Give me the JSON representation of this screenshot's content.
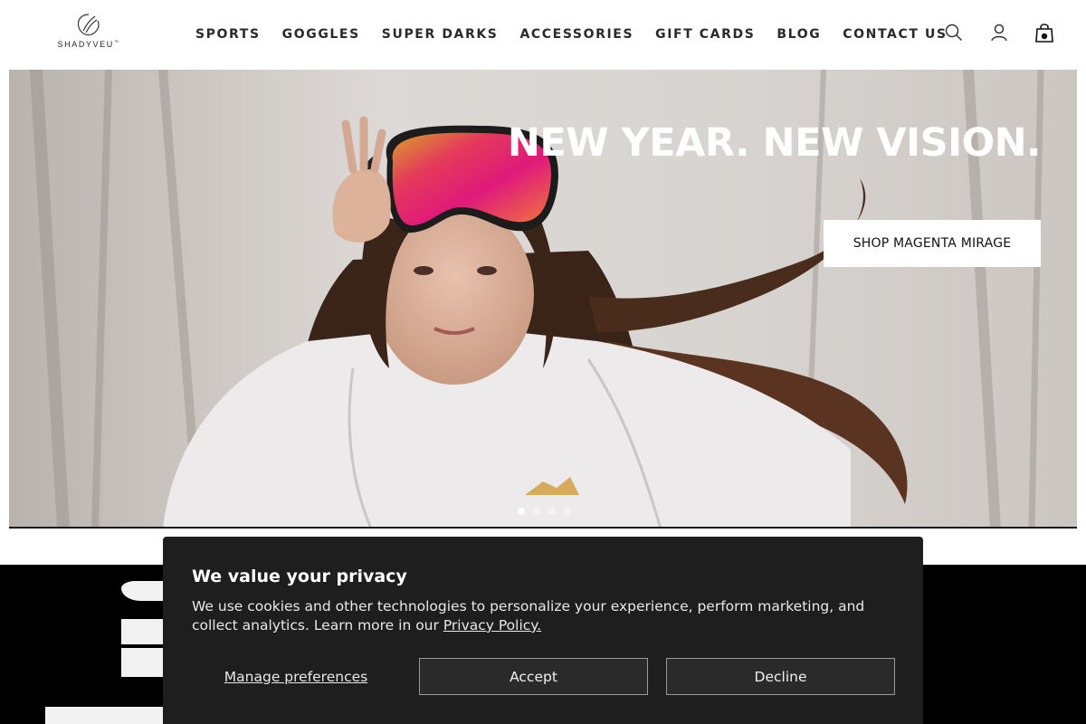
{
  "brand": {
    "name": "SHADYVEU",
    "trademark": "™"
  },
  "nav": {
    "items": [
      {
        "label": "SPORTS"
      },
      {
        "label": "GOGGLES"
      },
      {
        "label": "SUPER DARKS"
      },
      {
        "label": "ACCESSORIES"
      },
      {
        "label": "GIFT CARDS"
      },
      {
        "label": "BLOG"
      },
      {
        "label": "CONTACT US"
      }
    ]
  },
  "header_icons": [
    "search-icon",
    "account-icon",
    "cart-icon"
  ],
  "hero": {
    "headline": "NEW YEAR. NEW VISION.",
    "cta_label": "SHOP MAGENTA MIRAGE",
    "slides_count_shown": 4,
    "active_slide": 1
  },
  "cookie_banner": {
    "title": "We value your privacy",
    "text": "We use cookies and other technologies to personalize your experience, perform marketing, and collect analytics. Learn more in our ",
    "policy_link": "Privacy Policy.",
    "manage_label": "Manage preferences",
    "accept_label": "Accept",
    "decline_label": "Decline"
  },
  "colors": {
    "header_bg": "#ffffff",
    "nav_text": "#2a2a2a",
    "hero_text": "#ffffff",
    "banner_bg": "#1e1e1e",
    "section_bg": "#000000"
  }
}
